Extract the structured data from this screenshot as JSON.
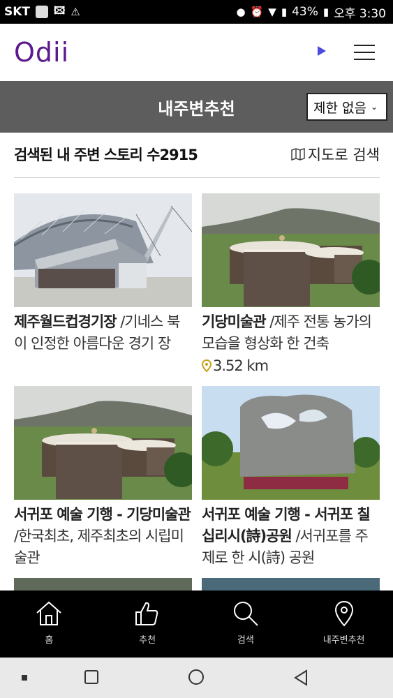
{
  "status_bar": {
    "carrier": "SKT",
    "battery": "43%",
    "time": "오후 3:30"
  },
  "app": {
    "logo": "Odii"
  },
  "header": {
    "title": "내주변추천",
    "filter_selected": "제한 없음"
  },
  "results": {
    "count_label": "검색된 내 주변 스토리 수2915",
    "map_search_label": "지도로 검색"
  },
  "cards": [
    {
      "title": "제주월드컵경기장",
      "desc": "/기네스 북이 인정한 아름다운 경기 장",
      "distance": ""
    },
    {
      "title": "기당미술관",
      "desc": "/제주 전통 농가의 모습을 형상화 한 건축",
      "distance": "3.52 km"
    },
    {
      "title": "서귀포 예술 기행 - 기당미술관",
      "desc": "/한국최초, 제주최초의 시립미술관",
      "distance": ""
    },
    {
      "title": "서귀포 예술 기행 - 서귀포 칠십리시(詩)공원",
      "desc": "/서귀포를 주제로 한 시(詩) 공원",
      "distance": ""
    }
  ],
  "bottom_nav": [
    {
      "label": "홈",
      "icon": "home-icon"
    },
    {
      "label": "추천",
      "icon": "thumbs-up-icon"
    },
    {
      "label": "검색",
      "icon": "search-icon"
    },
    {
      "label": "내주변추천",
      "icon": "location-pin-icon"
    }
  ],
  "colors": {
    "brand": "#5b1a8e",
    "title_bar": "#5d5d5d",
    "pin": "#c9a21b"
  }
}
